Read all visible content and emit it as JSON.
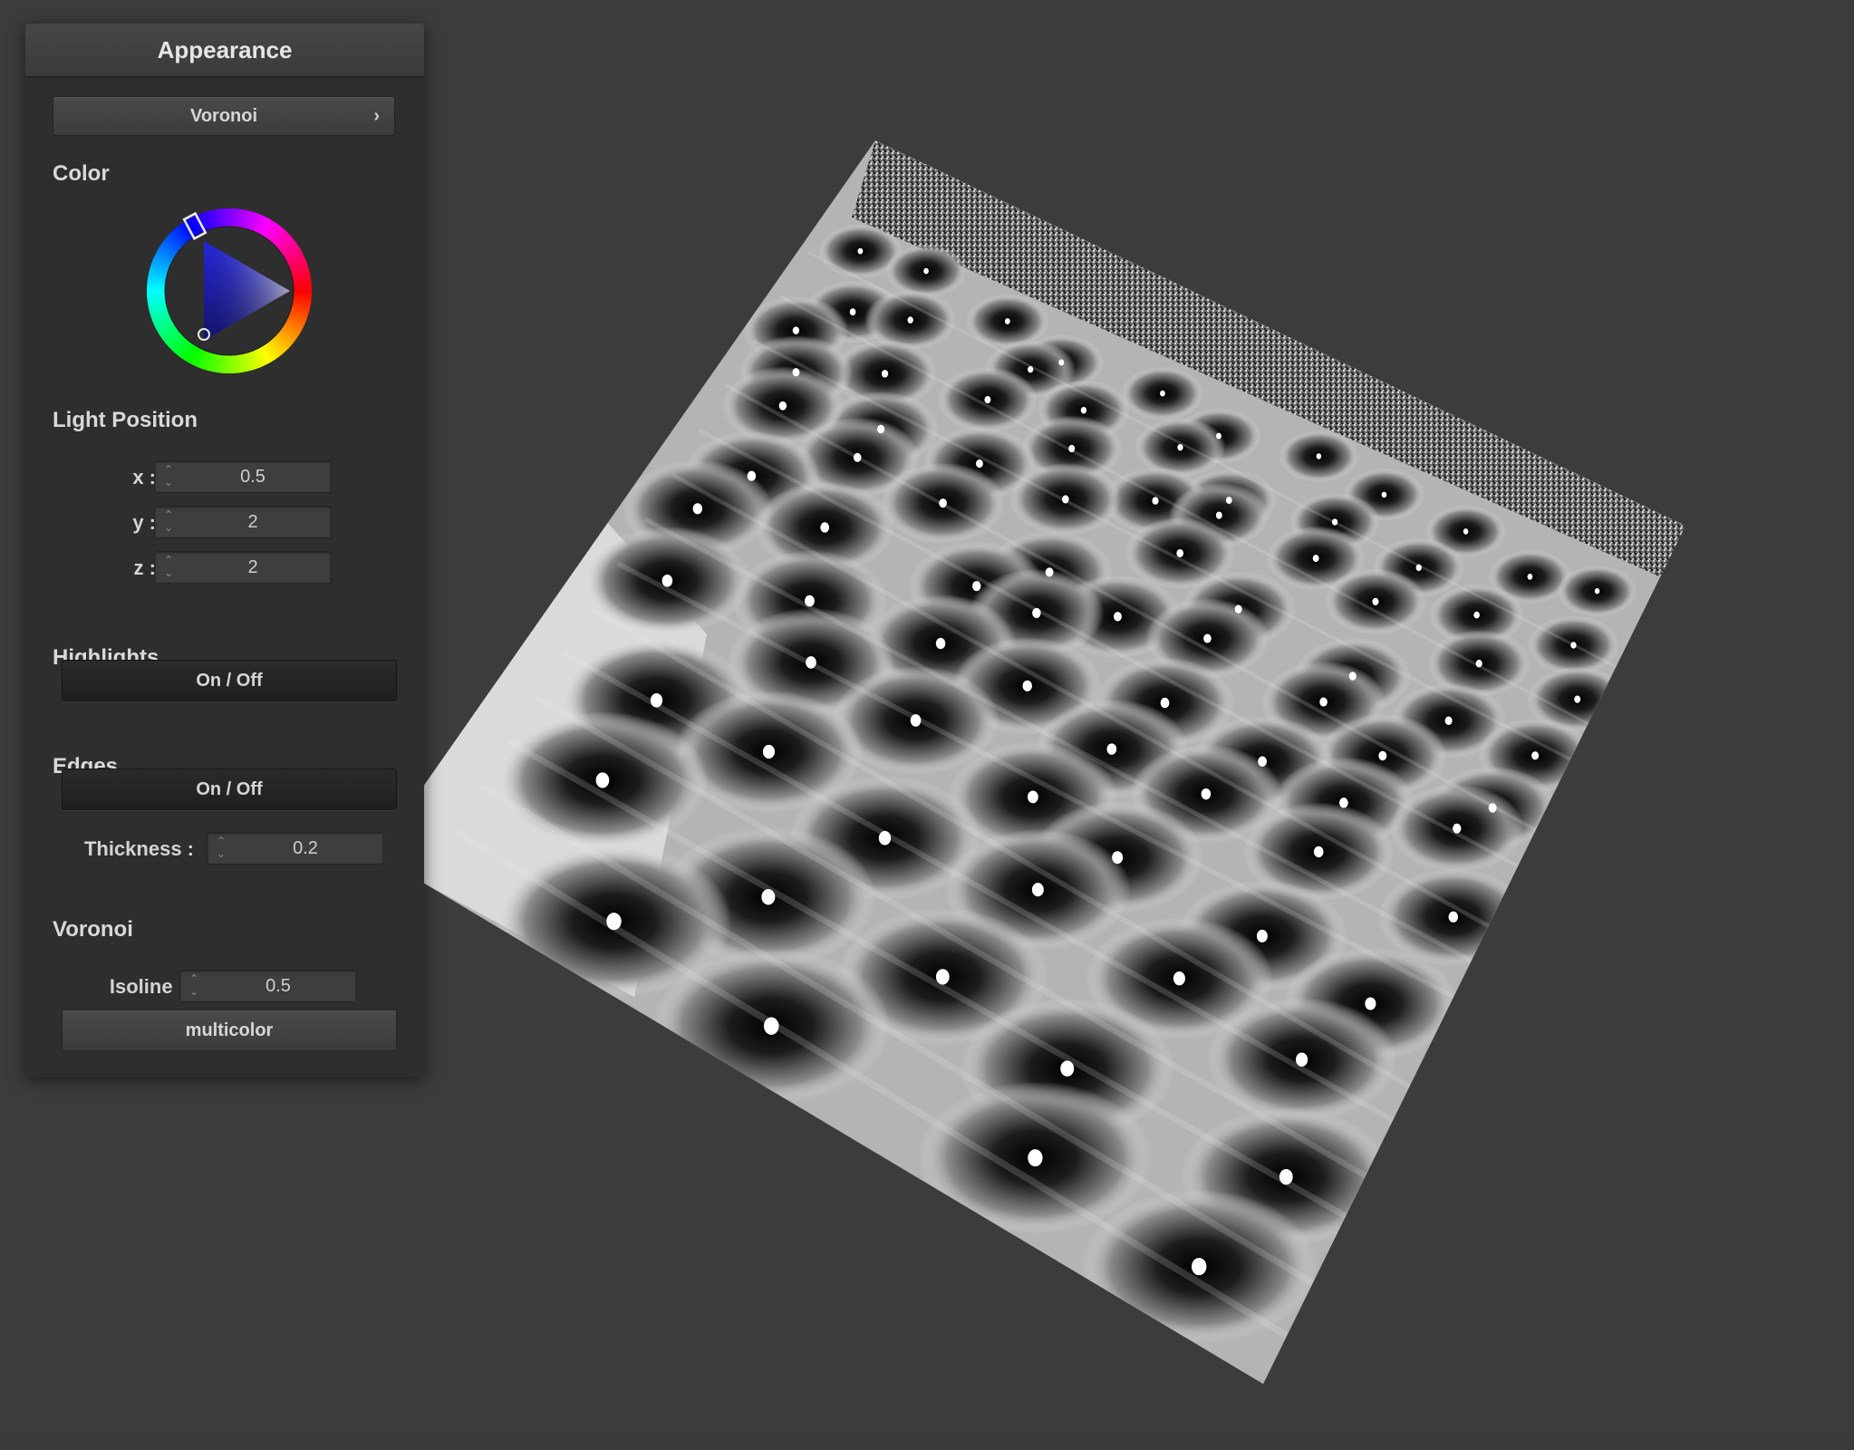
{
  "panel": {
    "title": "Appearance",
    "material_dropdown": {
      "label": "Voronoi",
      "chevron": "›"
    },
    "color": {
      "label": "Color",
      "ring_handle_hue_deg": 242,
      "selected_color": "#2a2a8c",
      "icons": {
        "wheel": "color-wheel-icon",
        "triangle": "saturation-value-triangle-icon"
      }
    },
    "light_position": {
      "label": "Light Position",
      "fields": [
        {
          "label": "x :",
          "value": "0.5"
        },
        {
          "label": "y :",
          "value": "2"
        },
        {
          "label": "z :",
          "value": "2"
        }
      ]
    },
    "highlights": {
      "label": "Highlights",
      "toggle_label": "On / Off"
    },
    "edges": {
      "label": "Edges",
      "toggle_label": "On / Off",
      "thickness": {
        "label": "Thickness :",
        "value": "0.2"
      }
    },
    "voronoi": {
      "label": "Voronoi",
      "isoline": {
        "label": "Isoline :",
        "value": "0.5"
      },
      "mode_button": "multicolor"
    }
  },
  "scene": {
    "description_icon": "voronoi-plane-render",
    "colors": {
      "background": "#3c3c3c",
      "cell_dark": "#0a0a0a",
      "cell_light": "#f2f2f2"
    }
  }
}
